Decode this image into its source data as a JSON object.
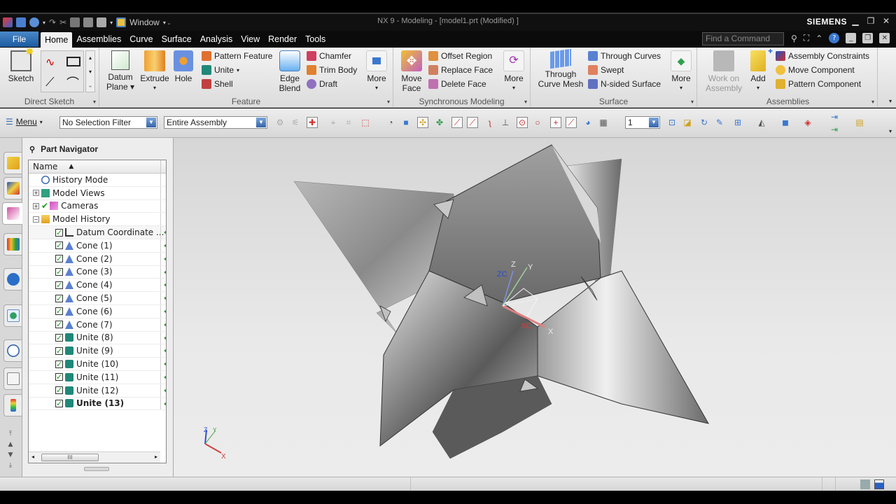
{
  "window": {
    "title": "NX 9 - Modeling - [model1.prt (Modified) ]",
    "brand": "SIEMENS",
    "qat_window_label": "Window"
  },
  "menubar": {
    "file_label": "File",
    "tabs": [
      "Home",
      "Assemblies",
      "Curve",
      "Surface",
      "Analysis",
      "View",
      "Render",
      "Tools"
    ],
    "active_tab": "Home",
    "find_command_placeholder": "Find a Command"
  },
  "ribbon": {
    "direct_sketch": {
      "label": "Direct Sketch",
      "sketch": "Sketch"
    },
    "feature": {
      "label": "Feature",
      "datum_plane": [
        "Datum",
        "Plane"
      ],
      "extrude": "Extrude",
      "hole": "Hole",
      "pattern_feature": "Pattern Feature",
      "unite": "Unite",
      "shell": "Shell",
      "edge_blend": [
        "Edge",
        "Blend"
      ],
      "chamfer": "Chamfer",
      "trim_body": "Trim Body",
      "draft": "Draft",
      "more": "More"
    },
    "synchronous": {
      "label": "Synchronous Modeling",
      "move_face": [
        "Move",
        "Face"
      ],
      "offset_region": "Offset Region",
      "replace_face": "Replace Face",
      "delete_face": "Delete Face",
      "more": "More"
    },
    "surface": {
      "label": "Surface",
      "through_curve_mesh": [
        "Through",
        "Curve Mesh"
      ],
      "through_curves": "Through Curves",
      "swept": "Swept",
      "n_sided": "N-sided Surface",
      "more": "More"
    },
    "assemblies": {
      "label": "Assemblies",
      "work_on_assembly": [
        "Work on",
        "Assembly"
      ],
      "add": "Add",
      "assembly_constraints": "Assembly Constraints",
      "move_component": "Move Component",
      "pattern_component": "Pattern Component"
    }
  },
  "toolbar": {
    "menu_label": "Menu",
    "selection_filter": "No Selection Filter",
    "scope": "Entire Assembly",
    "layer_value": "1"
  },
  "navigator": {
    "title": "Part Navigator",
    "column_name": "Name",
    "rows": [
      {
        "label": "History Mode",
        "level": 0,
        "expander": "",
        "checked": false,
        "icon": "clock"
      },
      {
        "label": "Model Views",
        "level": 0,
        "expander": "+",
        "checked": false,
        "icon": "views"
      },
      {
        "label": "Cameras",
        "level": 0,
        "expander": "+",
        "checked": true,
        "icon": "camera"
      },
      {
        "label": "Model History",
        "level": 0,
        "expander": "-",
        "checked": false,
        "icon": "folder"
      },
      {
        "label": "Datum Coordinate ...",
        "level": 1,
        "checked": true,
        "icon": "datum"
      },
      {
        "label": "Cone (1)",
        "level": 1,
        "checked": true,
        "icon": "cone"
      },
      {
        "label": "Cone (2)",
        "level": 1,
        "checked": true,
        "icon": "cone"
      },
      {
        "label": "Cone (3)",
        "level": 1,
        "checked": true,
        "icon": "cone"
      },
      {
        "label": "Cone (4)",
        "level": 1,
        "checked": true,
        "icon": "cone"
      },
      {
        "label": "Cone (5)",
        "level": 1,
        "checked": true,
        "icon": "cone"
      },
      {
        "label": "Cone (6)",
        "level": 1,
        "checked": true,
        "icon": "cone"
      },
      {
        "label": "Cone (7)",
        "level": 1,
        "checked": true,
        "icon": "cone"
      },
      {
        "label": "Unite (8)",
        "level": 1,
        "checked": true,
        "icon": "unite"
      },
      {
        "label": "Unite (9)",
        "level": 1,
        "checked": true,
        "icon": "unite"
      },
      {
        "label": "Unite (10)",
        "level": 1,
        "checked": true,
        "icon": "unite"
      },
      {
        "label": "Unite (11)",
        "level": 1,
        "checked": true,
        "icon": "unite"
      },
      {
        "label": "Unite (12)",
        "level": 1,
        "checked": true,
        "icon": "unite"
      },
      {
        "label": "Unite (13)",
        "level": 1,
        "checked": true,
        "icon": "unite",
        "bold": true
      }
    ]
  },
  "viewport": {
    "wcs_labels": {
      "zc": "ZC",
      "z": "Z",
      "y": "Y",
      "xc": "XC",
      "x": "X"
    },
    "triad_labels": {
      "z": "Z",
      "y": "Y",
      "x": "X"
    }
  },
  "colors": {
    "accent_blue": "#1c5aa0",
    "check_green": "#18a018",
    "axis_x": "#d04040",
    "axis_y": "#40a040",
    "axis_z": "#3050d0"
  }
}
